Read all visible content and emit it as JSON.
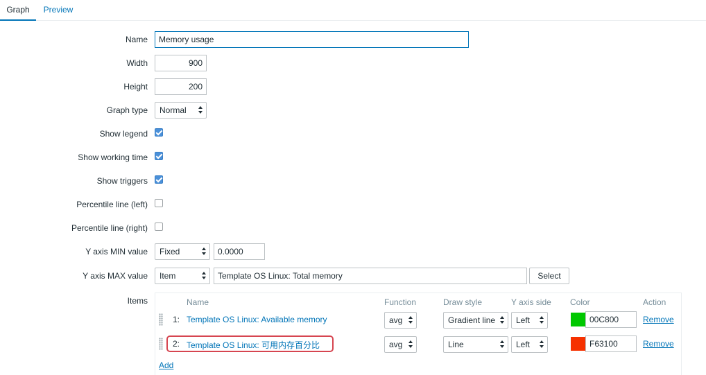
{
  "tabs": [
    {
      "label": "Graph",
      "active": true
    },
    {
      "label": "Preview",
      "active": false
    }
  ],
  "form": {
    "name": {
      "label": "Name",
      "value": "Memory usage"
    },
    "width": {
      "label": "Width",
      "value": "900"
    },
    "height": {
      "label": "Height",
      "value": "200"
    },
    "graph_type": {
      "label": "Graph type",
      "value": "Normal"
    },
    "show_legend": {
      "label": "Show legend",
      "checked": true
    },
    "show_working_time": {
      "label": "Show working time",
      "checked": true
    },
    "show_triggers": {
      "label": "Show triggers",
      "checked": true
    },
    "percentile_left": {
      "label": "Percentile line (left)",
      "checked": false
    },
    "percentile_right": {
      "label": "Percentile line (right)",
      "checked": false
    },
    "y_min": {
      "label": "Y axis MIN value",
      "type": "Fixed",
      "value": "0.0000"
    },
    "y_max": {
      "label": "Y axis MAX value",
      "type": "Item",
      "value": "Template OS Linux: Total memory",
      "button": "Select"
    },
    "items_label": "Items"
  },
  "items": {
    "headers": {
      "name": "Name",
      "function": "Function",
      "draw_style": "Draw style",
      "y_axis_side": "Y axis side",
      "color": "Color",
      "action": "Action"
    },
    "rows": [
      {
        "index": "1:",
        "name": "Template OS Linux: Available memory",
        "function": "avg",
        "draw_style": "Gradient line",
        "y_axis_side": "Left",
        "color": "00C800",
        "color_hex": "#00c800",
        "action": "Remove"
      },
      {
        "index": "2:",
        "name": "Template OS Linux: 可用内存百分比",
        "function": "avg",
        "draw_style": "Line",
        "y_axis_side": "Left",
        "color": "F63100",
        "color_hex": "#f63100",
        "action": "Remove"
      }
    ],
    "add_label": "Add"
  },
  "colors": {
    "accent": "#0275b8",
    "highlight": "#d64550",
    "checkbox": "#4a90d9"
  }
}
